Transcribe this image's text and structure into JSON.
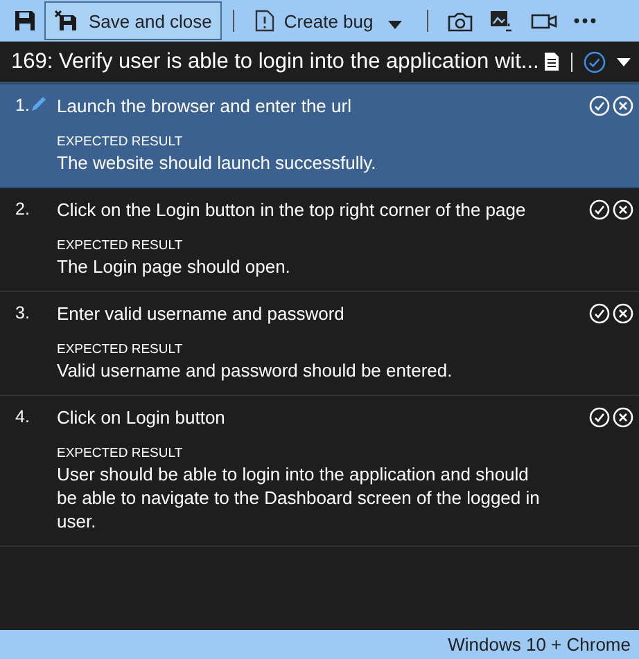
{
  "toolbar": {
    "items": [
      {
        "kind": "icon"
      },
      {
        "kind": "button",
        "label": "Save and close",
        "selected": true
      },
      {
        "kind": "separator"
      },
      {
        "kind": "button",
        "label": "Create bug",
        "selected": false
      },
      {
        "kind": "dropdown"
      },
      {
        "kind": "separator"
      },
      {
        "kind": "icon"
      },
      {
        "kind": "icon"
      },
      {
        "kind": "icon"
      },
      {
        "kind": "icon"
      }
    ]
  },
  "header": {
    "title": "169: Verify user is able to login into the application wit..."
  },
  "steps": [
    {
      "number": "1.",
      "action": "Launch the browser and enter the url",
      "expected_label": "EXPECTED RESULT",
      "expected": "The website should launch successfully.",
      "selected": true
    },
    {
      "number": "2.",
      "action": "Click on the Login button in the top right corner of the page",
      "expected_label": "EXPECTED RESULT",
      "expected": "The Login page should open.",
      "selected": false
    },
    {
      "number": "3.",
      "action": "Enter valid username and password",
      "expected_label": "EXPECTED RESULT",
      "expected": "Valid username and password should be entered.",
      "selected": false
    },
    {
      "number": "4.",
      "action": "Click on Login button",
      "expected_label": "EXPECTED RESULT",
      "expected": "User should be able to login into the application and should be able to navigate to the Dashboard screen of the logged in user.",
      "selected": false
    }
  ],
  "status_bar": {
    "text": "Windows 10 + Chrome"
  }
}
